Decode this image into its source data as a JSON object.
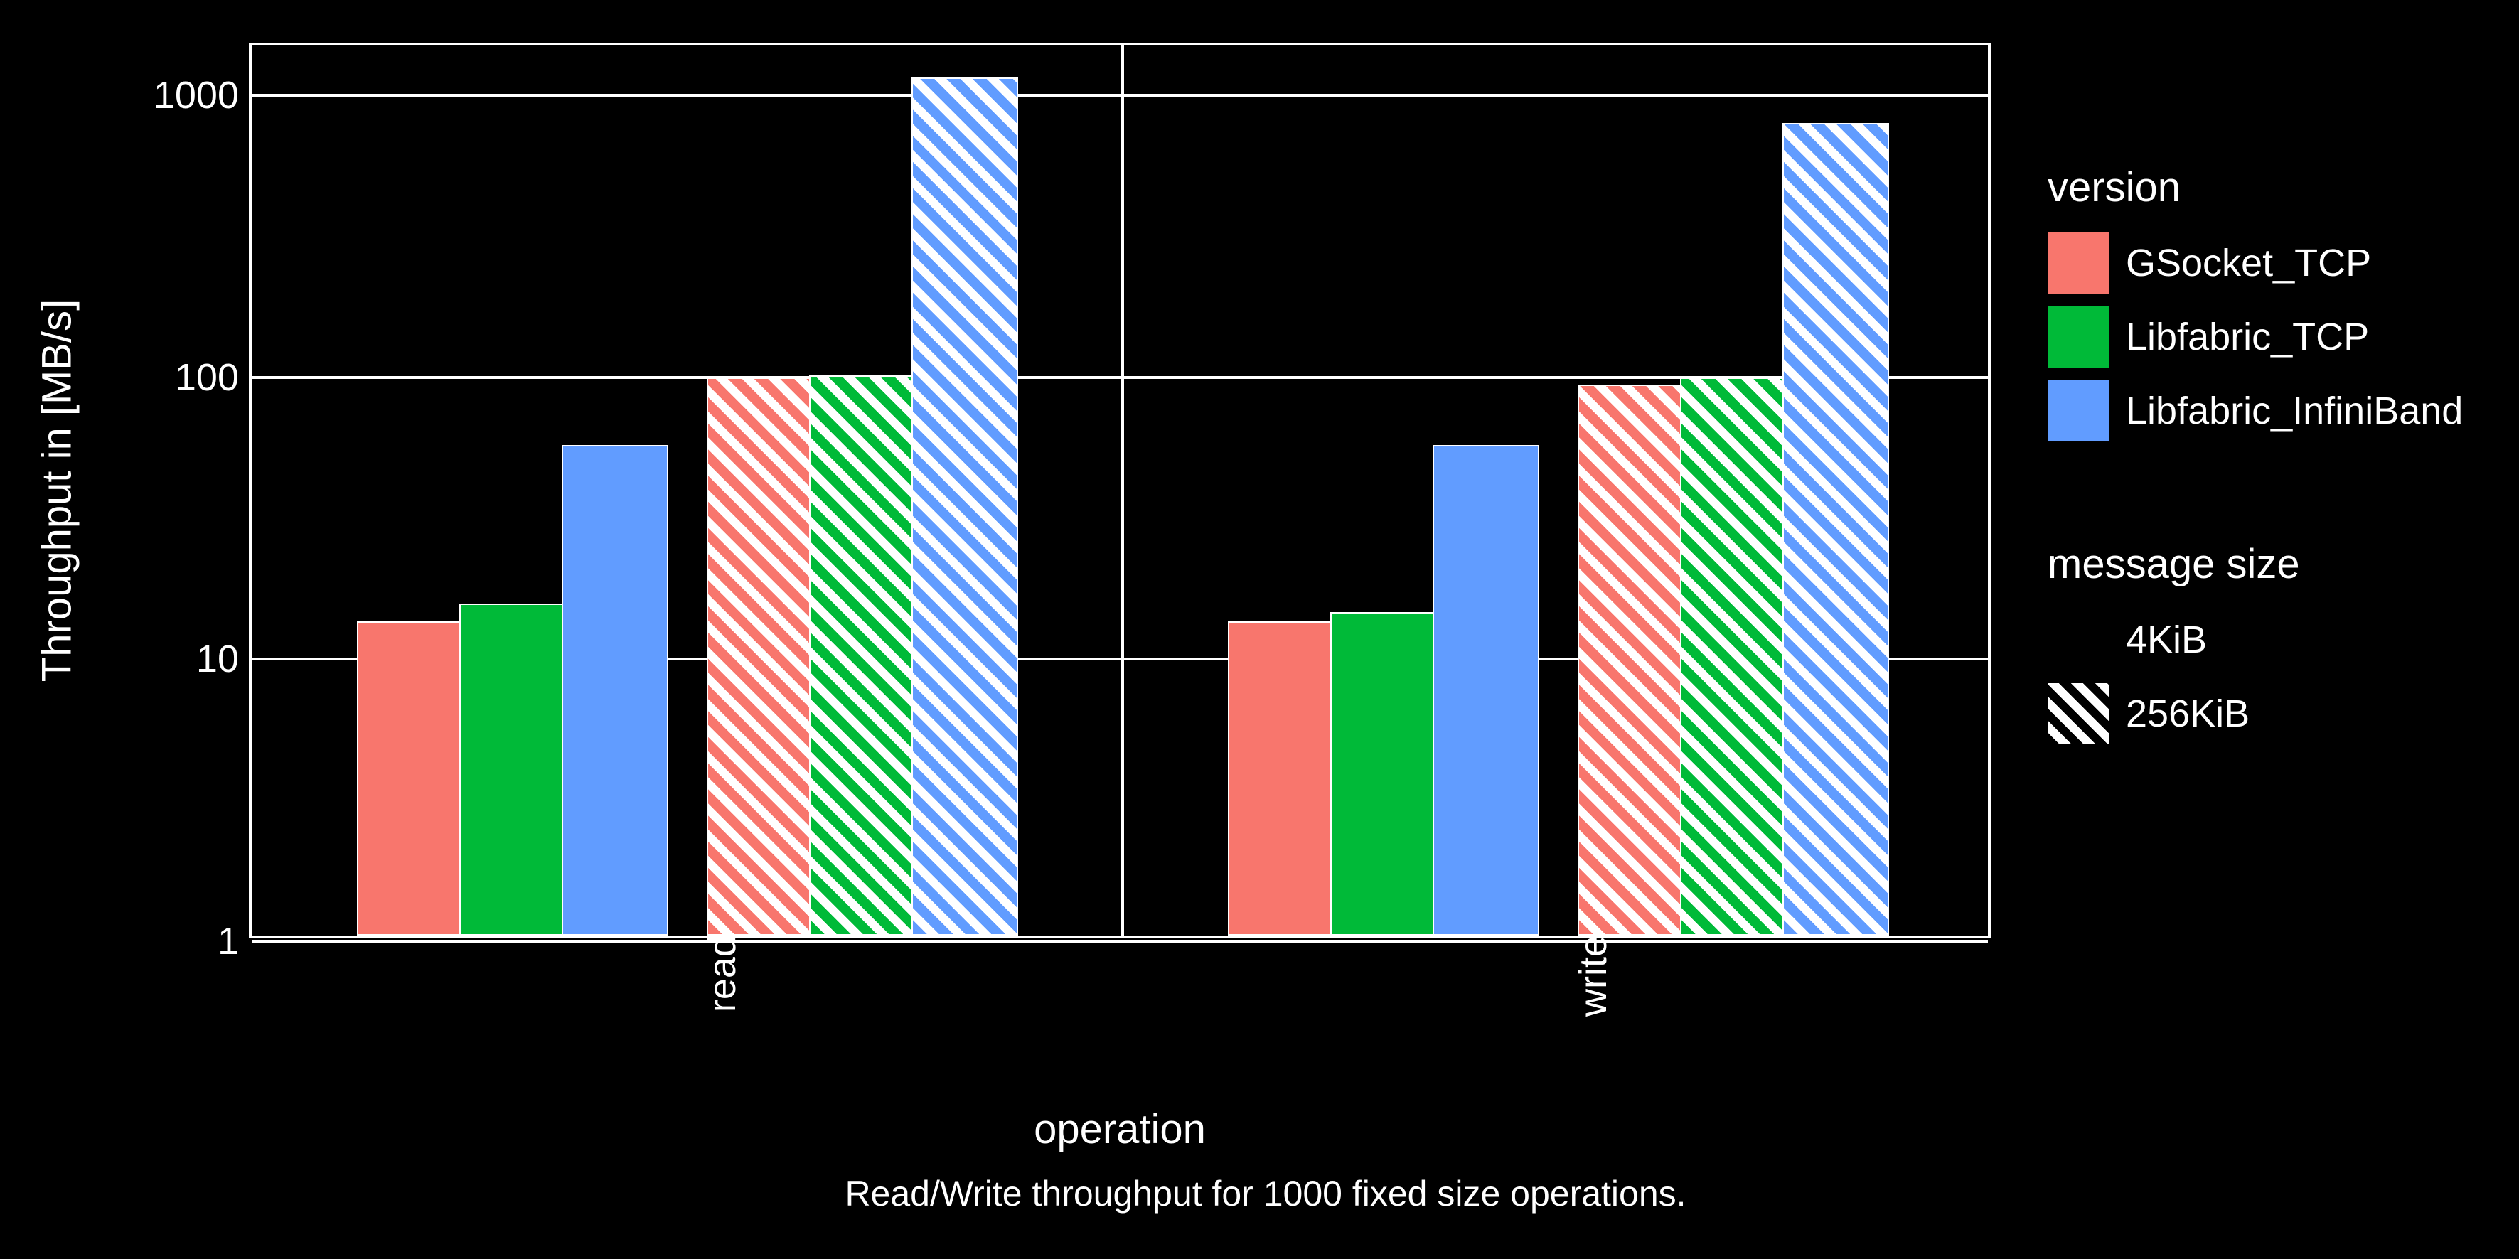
{
  "chart_data": {
    "type": "bar",
    "title": "",
    "subtitle": "Read/Write throughput for 1000 fixed size operations.",
    "xlabel": "operation",
    "ylabel": "Throughput in [MB/s]",
    "yscale": "log",
    "ylim": [
      1,
      1500
    ],
    "yticks": [
      1,
      10,
      100,
      1000
    ],
    "facets": [
      "read",
      "write"
    ],
    "versions": [
      "GSocket_TCP",
      "Libfabric_TCP",
      "Libfabric_InfiniBand"
    ],
    "message_sizes": [
      "4KiB",
      "256KiB"
    ],
    "series": [
      {
        "facet": "read",
        "version": "GSocket_TCP",
        "size": "4KiB",
        "value": 13
      },
      {
        "facet": "read",
        "version": "Libfabric_TCP",
        "size": "4KiB",
        "value": 15
      },
      {
        "facet": "read",
        "version": "Libfabric_InfiniBand",
        "size": "4KiB",
        "value": 55
      },
      {
        "facet": "read",
        "version": "GSocket_TCP",
        "size": "256KiB",
        "value": 95
      },
      {
        "facet": "read",
        "version": "Libfabric_TCP",
        "size": "256KiB",
        "value": 97
      },
      {
        "facet": "read",
        "version": "Libfabric_InfiniBand",
        "size": "256KiB",
        "value": 1100
      },
      {
        "facet": "write",
        "version": "GSocket_TCP",
        "size": "4KiB",
        "value": 13
      },
      {
        "facet": "write",
        "version": "Libfabric_TCP",
        "size": "4KiB",
        "value": 14
      },
      {
        "facet": "write",
        "version": "Libfabric_InfiniBand",
        "size": "4KiB",
        "value": 55
      },
      {
        "facet": "write",
        "version": "GSocket_TCP",
        "size": "256KiB",
        "value": 90
      },
      {
        "facet": "write",
        "version": "Libfabric_TCP",
        "size": "256KiB",
        "value": 95
      },
      {
        "facet": "write",
        "version": "Libfabric_InfiniBand",
        "size": "256KiB",
        "value": 760
      }
    ],
    "colors": {
      "GSocket_TCP": "#f8766d",
      "Libfabric_TCP": "#00ba38",
      "Libfabric_InfiniBand": "#619cff"
    },
    "pattern": {
      "4KiB": "solid",
      "256KiB": "hatched"
    }
  },
  "legend": {
    "version_title": "version",
    "size_title": "message size"
  }
}
